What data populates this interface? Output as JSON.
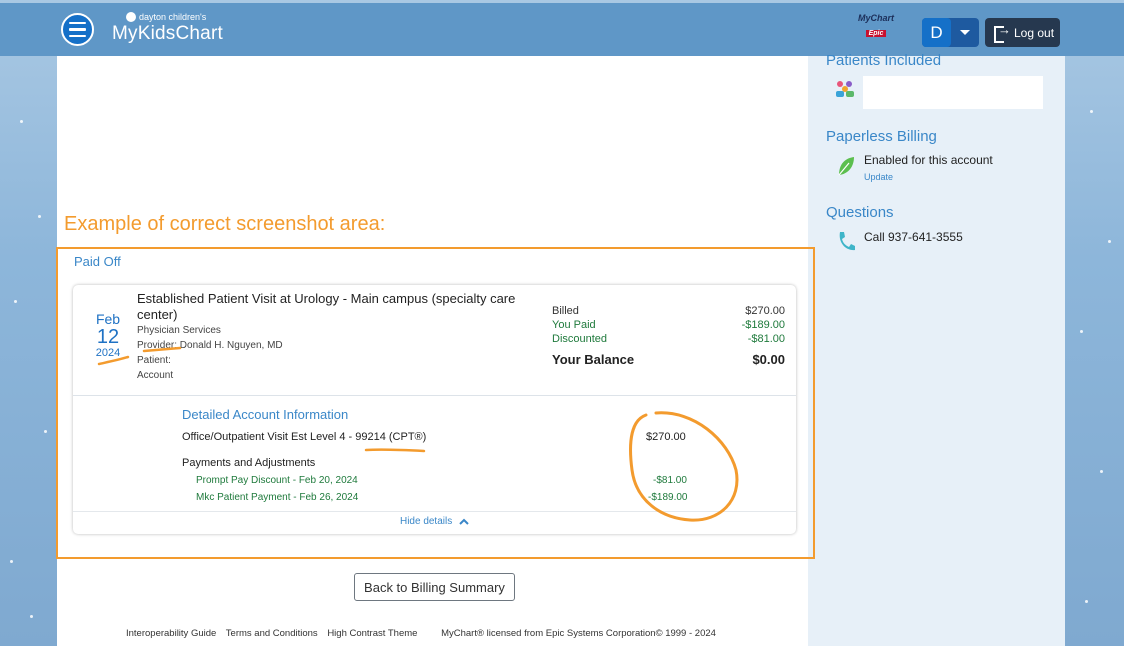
{
  "header": {
    "brand_small": "dayton children's",
    "brand_main": "MyKidsChart",
    "mychart_logo_text": "MyChart",
    "epic_text": "Epic",
    "user_initial": "D",
    "logout_label": "Log out"
  },
  "annotation": {
    "label": "Example of correct screenshot area:",
    "color": "#f39b2e"
  },
  "section_title": "Paid Off",
  "visit": {
    "date_month": "Feb",
    "date_day": "12",
    "date_year": "2024",
    "title": "Established Patient Visit at Urology - Main campus (specialty care center)",
    "service": "Physician Services",
    "provider": "Provider: Donald H. Nguyen, MD",
    "patient": "Patient:",
    "account": "Account"
  },
  "balance": {
    "billed_label": "Billed",
    "billed_value": "$270.00",
    "paid_label": "You Paid",
    "paid_value": "-$189.00",
    "discount_label": "Discounted",
    "discount_value": "-$81.00",
    "balance_label": "Your Balance",
    "balance_value": "$0.00"
  },
  "details": {
    "heading": "Detailed Account Information",
    "charge_label": "Office/Outpatient Visit Est Level 4 - 99214 (CPT®)",
    "charge_amount": "$270.00",
    "payments_heading": "Payments and Adjustments",
    "payments": [
      {
        "label": "Prompt Pay Discount - Feb 20, 2024",
        "amount": "-$81.00"
      },
      {
        "label": "Mkc Patient Payment - Feb 26, 2024",
        "amount": "-$189.00"
      }
    ],
    "hide_label": "Hide details"
  },
  "back_button": "Back to Billing Summary",
  "footer": {
    "links": [
      "Interoperability Guide",
      "Terms and Conditions",
      "High Contrast Theme"
    ],
    "copyright": "MyChart® licensed from Epic Systems Corporation© 1999 - 2024"
  },
  "sidebar": {
    "patients_heading": "Patients Included",
    "paperless_heading": "Paperless Billing",
    "paperless_status": "Enabled for this account",
    "paperless_update": "Update",
    "questions_heading": "Questions",
    "questions_phone": "Call 937-641-3555"
  }
}
